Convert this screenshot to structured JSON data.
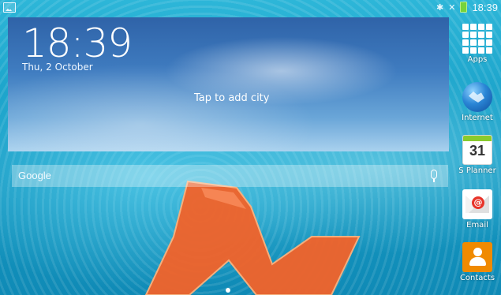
{
  "statusbar": {
    "time": "18:39"
  },
  "clock": {
    "time": "18:39",
    "date": "Thu, 2 October"
  },
  "weather": {
    "add_city": "Tap to add city"
  },
  "search": {
    "logo": "Google"
  },
  "dock": [
    {
      "label": "Apps",
      "icon": "apps-grid-icon"
    },
    {
      "label": "Internet",
      "icon": "globe-icon"
    },
    {
      "label": "S Planner",
      "icon": "calendar-icon",
      "day": "31"
    },
    {
      "label": "Email",
      "icon": "email-icon"
    },
    {
      "label": "Contacts",
      "icon": "contacts-icon"
    }
  ],
  "colors": {
    "accent_green": "#76d33a",
    "wallpaper_logo": "#f2632a"
  }
}
